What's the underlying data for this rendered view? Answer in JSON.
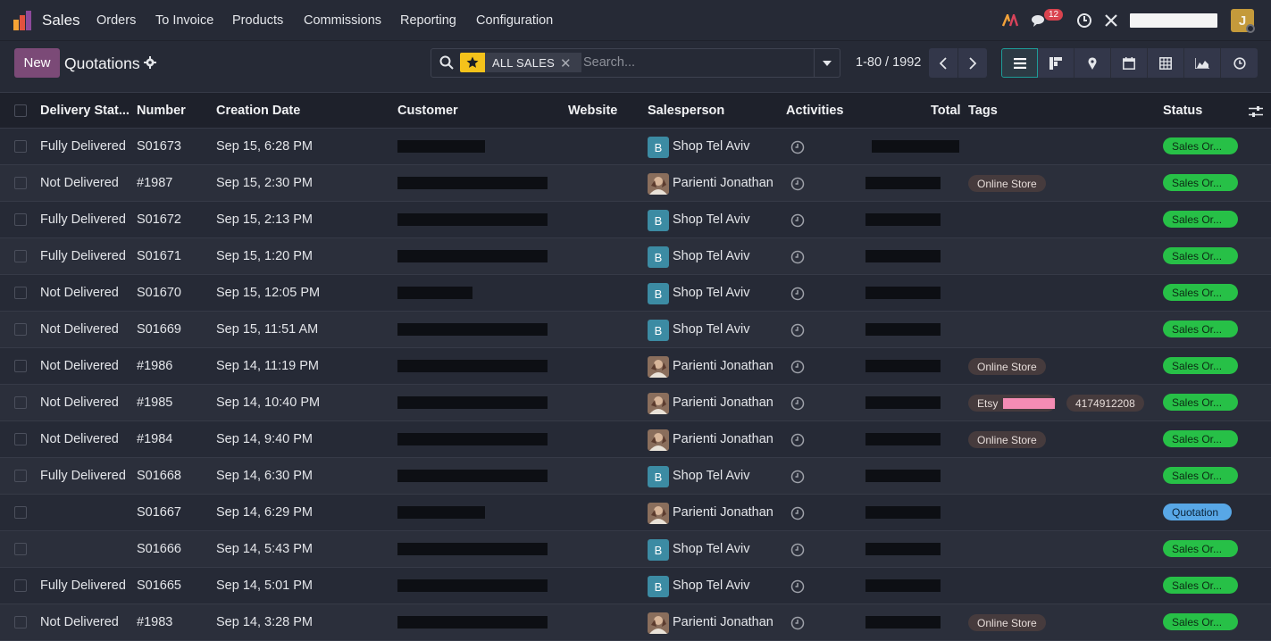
{
  "navbar": {
    "app_name": "Sales",
    "menu": [
      "Orders",
      "To Invoice",
      "Products",
      "Commissions",
      "Reporting",
      "Configuration"
    ],
    "messages_count": "12",
    "user_initial": "J"
  },
  "control": {
    "new_label": "New",
    "title": "Quotations",
    "search": {
      "facet": "ALL SALES",
      "placeholder": "Search..."
    },
    "pager": "1-80 / 1992"
  },
  "columns": [
    "Delivery Stat...",
    "Number",
    "Creation Date",
    "Customer",
    "Website",
    "Salesperson",
    "Activities",
    "Total",
    "Tags",
    "Status"
  ],
  "rows": [
    {
      "delivery": "Fully Delivered",
      "number": "S01673",
      "date": "Sep 15, 6:28 PM",
      "salesperson": "Shop Tel Aviv",
      "sp_type": "B",
      "tags": [],
      "status": "Sales Or..."
    },
    {
      "delivery": "Not Delivered",
      "number": "#1987",
      "date": "Sep 15, 2:30 PM",
      "salesperson": "Parienti Jonathan",
      "sp_type": "img",
      "tags": [
        "Online Store"
      ],
      "status": "Sales Or..."
    },
    {
      "delivery": "Fully Delivered",
      "number": "S01672",
      "date": "Sep 15, 2:13 PM",
      "salesperson": "Shop Tel Aviv",
      "sp_type": "B",
      "tags": [],
      "status": "Sales Or..."
    },
    {
      "delivery": "Fully Delivered",
      "number": "S01671",
      "date": "Sep 15, 1:20 PM",
      "salesperson": "Shop Tel Aviv",
      "sp_type": "B",
      "tags": [],
      "status": "Sales Or..."
    },
    {
      "delivery": "Not Delivered",
      "number": "S01670",
      "date": "Sep 15, 12:05 PM",
      "salesperson": "Shop Tel Aviv",
      "sp_type": "B",
      "tags": [],
      "status": "Sales Or..."
    },
    {
      "delivery": "Not Delivered",
      "number": "S01669",
      "date": "Sep 15, 11:51 AM",
      "salesperson": "Shop Tel Aviv",
      "sp_type": "B",
      "tags": [],
      "status": "Sales Or..."
    },
    {
      "delivery": "Not Delivered",
      "number": "#1986",
      "date": "Sep 14, 11:19 PM",
      "salesperson": "Parienti Jonathan",
      "sp_type": "img",
      "tags": [
        "Online Store"
      ],
      "status": "Sales Or..."
    },
    {
      "delivery": "Not Delivered",
      "number": "#1985",
      "date": "Sep 14, 10:40 PM",
      "salesperson": "Parienti Jonathan",
      "sp_type": "img",
      "tags": [
        "Etsy",
        "4174912208"
      ],
      "status": "Sales Or..."
    },
    {
      "delivery": "Not Delivered",
      "number": "#1984",
      "date": "Sep 14, 9:40 PM",
      "salesperson": "Parienti Jonathan",
      "sp_type": "img",
      "tags": [
        "Online Store"
      ],
      "status": "Sales Or..."
    },
    {
      "delivery": "Fully Delivered",
      "number": "S01668",
      "date": "Sep 14, 6:30 PM",
      "salesperson": "Shop Tel Aviv",
      "sp_type": "B",
      "tags": [],
      "status": "Sales Or..."
    },
    {
      "delivery": "",
      "number": "S01667",
      "date": "Sep 14, 6:29 PM",
      "salesperson": "Parienti Jonathan",
      "sp_type": "img",
      "tags": [],
      "status": "Quotation"
    },
    {
      "delivery": "",
      "number": "S01666",
      "date": "Sep 14, 5:43 PM",
      "salesperson": "Shop Tel Aviv",
      "sp_type": "B",
      "tags": [],
      "status": "Sales Or..."
    },
    {
      "delivery": "Fully Delivered",
      "number": "S01665",
      "date": "Sep 14, 5:01 PM",
      "salesperson": "Shop Tel Aviv",
      "sp_type": "B",
      "tags": [],
      "status": "Sales Or..."
    },
    {
      "delivery": "Not Delivered",
      "number": "#1983",
      "date": "Sep 14, 3:28 PM",
      "salesperson": "Parienti Jonathan",
      "sp_type": "img",
      "tags": [
        "Online Store"
      ],
      "status": "Sales Or..."
    }
  ],
  "colors": {
    "accent_new": "#7b4a77",
    "status_sales": "#27c047",
    "status_quote": "#58a7e6",
    "facet": "#f4c21b"
  }
}
